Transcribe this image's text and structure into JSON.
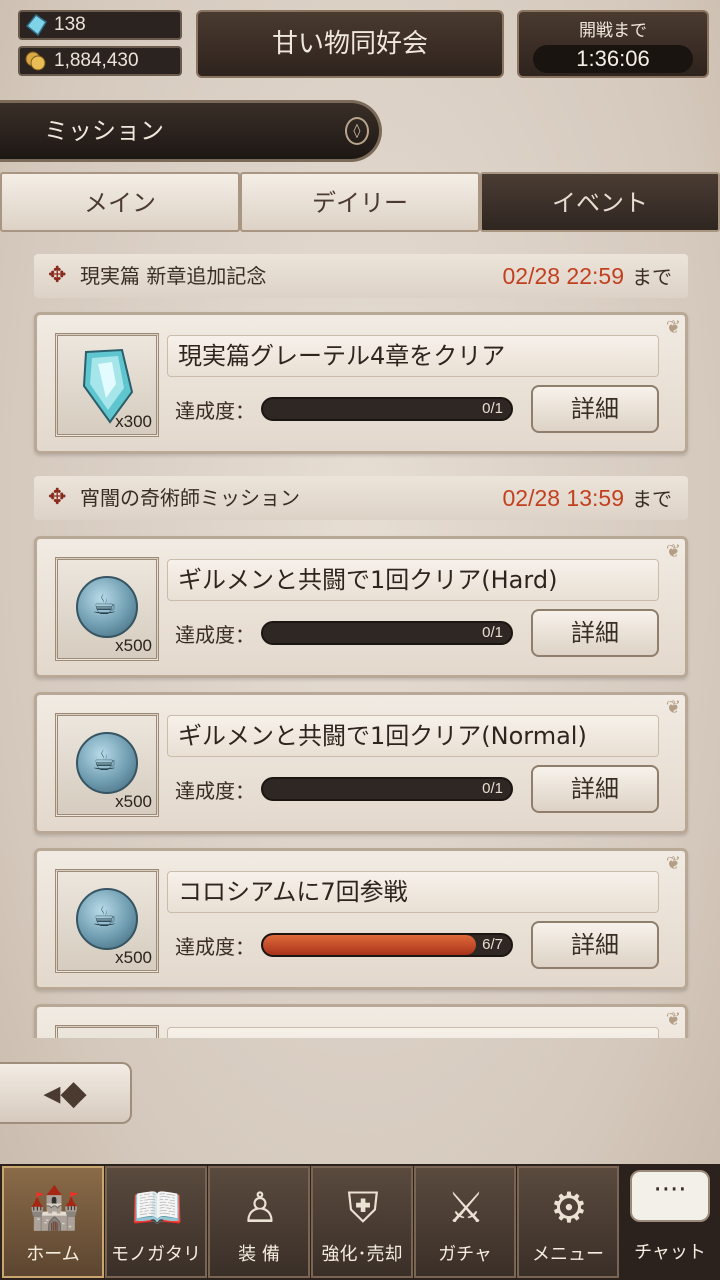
{
  "top": {
    "gems": "138",
    "gold": "1,884,430",
    "guild_name": "甘い物同好会",
    "timer_label": "開戦まで",
    "timer_value": "1:36:06"
  },
  "section_title": "ミッション",
  "tabs": [
    {
      "label": "メイン",
      "active": false
    },
    {
      "label": "デイリー",
      "active": false
    },
    {
      "label": "イベント",
      "active": true
    }
  ],
  "groups": [
    {
      "title": "現実篇 新章追加記念",
      "deadline": "02/28 22:59",
      "deadline_suffix": "まで",
      "missions": [
        {
          "name": "現実篇グレーテル4章をクリア",
          "progress_label": "達成度：",
          "progress": "0/1",
          "progress_fraction": 0,
          "reward_qty": "x300",
          "reward_icon": "crystal-icon",
          "detail_label": "詳細"
        }
      ]
    },
    {
      "title": "宵闇の奇術師ミッション",
      "deadline": "02/28 13:59",
      "deadline_suffix": "まで",
      "missions": [
        {
          "name": "ギルメンと共闘で1回クリア(Hard)",
          "progress_label": "達成度：",
          "progress": "0/1",
          "progress_fraction": 0,
          "reward_qty": "x500",
          "reward_icon": "coin-icon",
          "detail_label": "詳細"
        },
        {
          "name": "ギルメンと共闘で1回クリア(Normal)",
          "progress_label": "達成度：",
          "progress": "0/1",
          "progress_fraction": 0,
          "reward_qty": "x500",
          "reward_icon": "coin-icon",
          "detail_label": "詳細"
        },
        {
          "name": "コロシアムに7回参戦",
          "progress_label": "達成度：",
          "progress": "6/7",
          "progress_fraction": 0.857,
          "reward_qty": "x500",
          "reward_icon": "coin-icon",
          "detail_label": "詳細"
        }
      ]
    }
  ],
  "nav": [
    {
      "label": "ホーム",
      "icon": "home-icon",
      "active": true
    },
    {
      "label": "モノガタリ",
      "icon": "book-icon",
      "active": false
    },
    {
      "label": "装 備",
      "icon": "equipment-icon",
      "active": false
    },
    {
      "label": "強化･売却",
      "icon": "enhance-icon",
      "active": false
    },
    {
      "label": "ガチャ",
      "icon": "gacha-icon",
      "active": false
    },
    {
      "label": "メニュー",
      "icon": "gear-icon",
      "active": false
    }
  ],
  "chat": {
    "label": "チャット",
    "bubble": "····"
  }
}
